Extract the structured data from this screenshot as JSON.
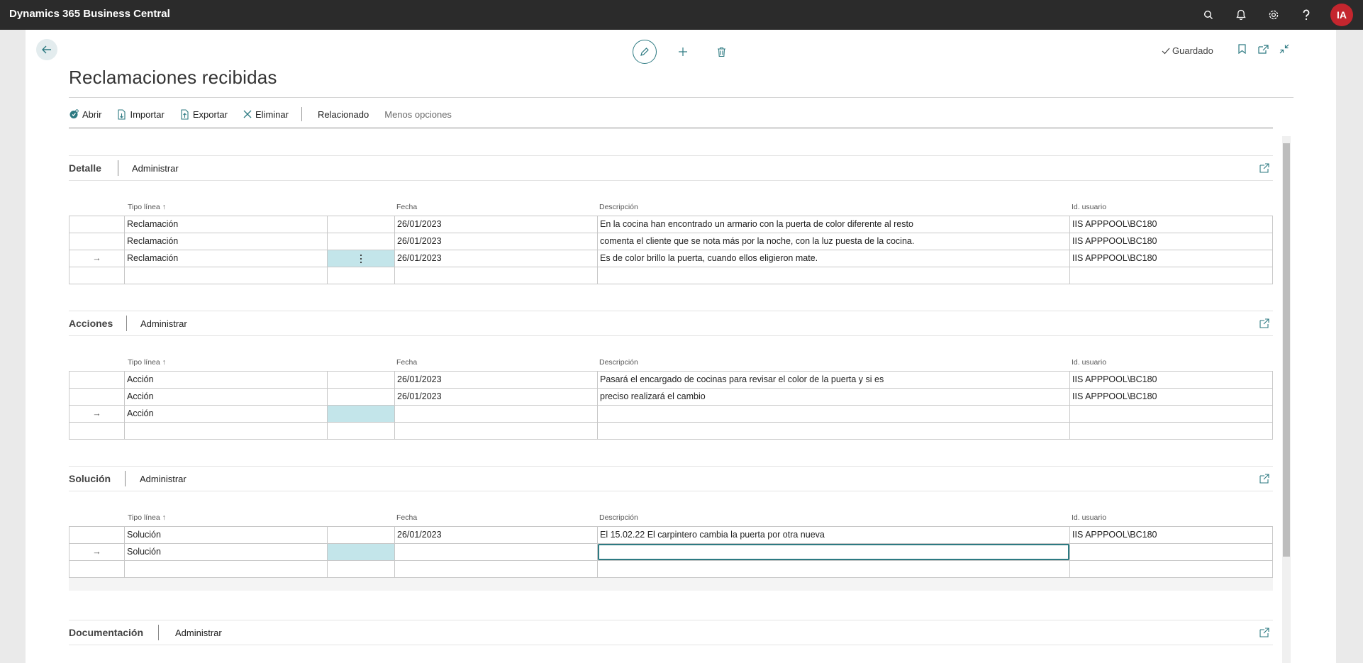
{
  "app": {
    "title": "Dynamics 365 Business Central",
    "avatar_initials": "IA",
    "icons": [
      "search-icon",
      "bell-icon",
      "gear-icon",
      "help-icon"
    ]
  },
  "page": {
    "title": "Reclamaciones recibidas",
    "status": "Guardado"
  },
  "actions": {
    "abrir": "Abrir",
    "importar": "Importar",
    "exportar": "Exportar",
    "eliminar": "Eliminar",
    "relacionado": "Relacionado",
    "menos_opciones": "Menos opciones"
  },
  "columns": {
    "tipo": "Tipo línea ↑",
    "fecha": "Fecha",
    "descripcion": "Descripción",
    "usuario": "Id. usuario"
  },
  "parts": {
    "detalle": {
      "title": "Detalle",
      "manage": "Administrar",
      "rows": [
        {
          "marker": "",
          "tipo": "Reclamación",
          "fecha": "26/01/2023",
          "descripcion": "En la cocina han encontrado un armario con la puerta de color diferente al resto",
          "usuario": "IIS APPPOOL\\BC180"
        },
        {
          "marker": "",
          "tipo": "Reclamación",
          "fecha": "26/01/2023",
          "descripcion": "comenta el cliente que se nota más por la noche, con la luz puesta de la cocina.",
          "usuario": "IIS APPPOOL\\BC180"
        },
        {
          "marker": "→",
          "tipo": "Reclamación",
          "fecha": "26/01/2023",
          "descripcion": "Es de color brillo la puerta, cuando ellos eligieron mate.",
          "usuario": "IIS APPPOOL\\BC180"
        }
      ]
    },
    "acciones": {
      "title": "Acciones",
      "manage": "Administrar",
      "rows": [
        {
          "marker": "",
          "tipo": "Acción",
          "fecha": "26/01/2023",
          "descripcion": "Pasará el encargado de cocinas para revisar el color de la puerta y si es",
          "usuario": "IIS APPPOOL\\BC180"
        },
        {
          "marker": "",
          "tipo": "Acción",
          "fecha": "26/01/2023",
          "descripcion": "preciso realizará el cambio",
          "usuario": "IIS APPPOOL\\BC180"
        },
        {
          "marker": "→",
          "tipo": "Acción",
          "fecha": "",
          "descripcion": "",
          "usuario": ""
        }
      ]
    },
    "solucion": {
      "title": "Solución",
      "manage": "Administrar",
      "rows": [
        {
          "marker": "",
          "tipo": "Solución",
          "fecha": "26/01/2023",
          "descripcion": "El 15.02.22 El carpintero cambia la puerta por otra nueva",
          "usuario": "IIS APPPOOL\\BC180"
        },
        {
          "marker": "→",
          "tipo": "Solución",
          "fecha": "",
          "descripcion": "",
          "usuario": ""
        }
      ]
    },
    "documentacion": {
      "title": "Documentación",
      "manage": "Administrar"
    }
  },
  "colors": {
    "accent": "#2d7a82",
    "selection": "#c3e5ea",
    "topbar": "#2b2b2b",
    "avatar": "#c4262e"
  }
}
